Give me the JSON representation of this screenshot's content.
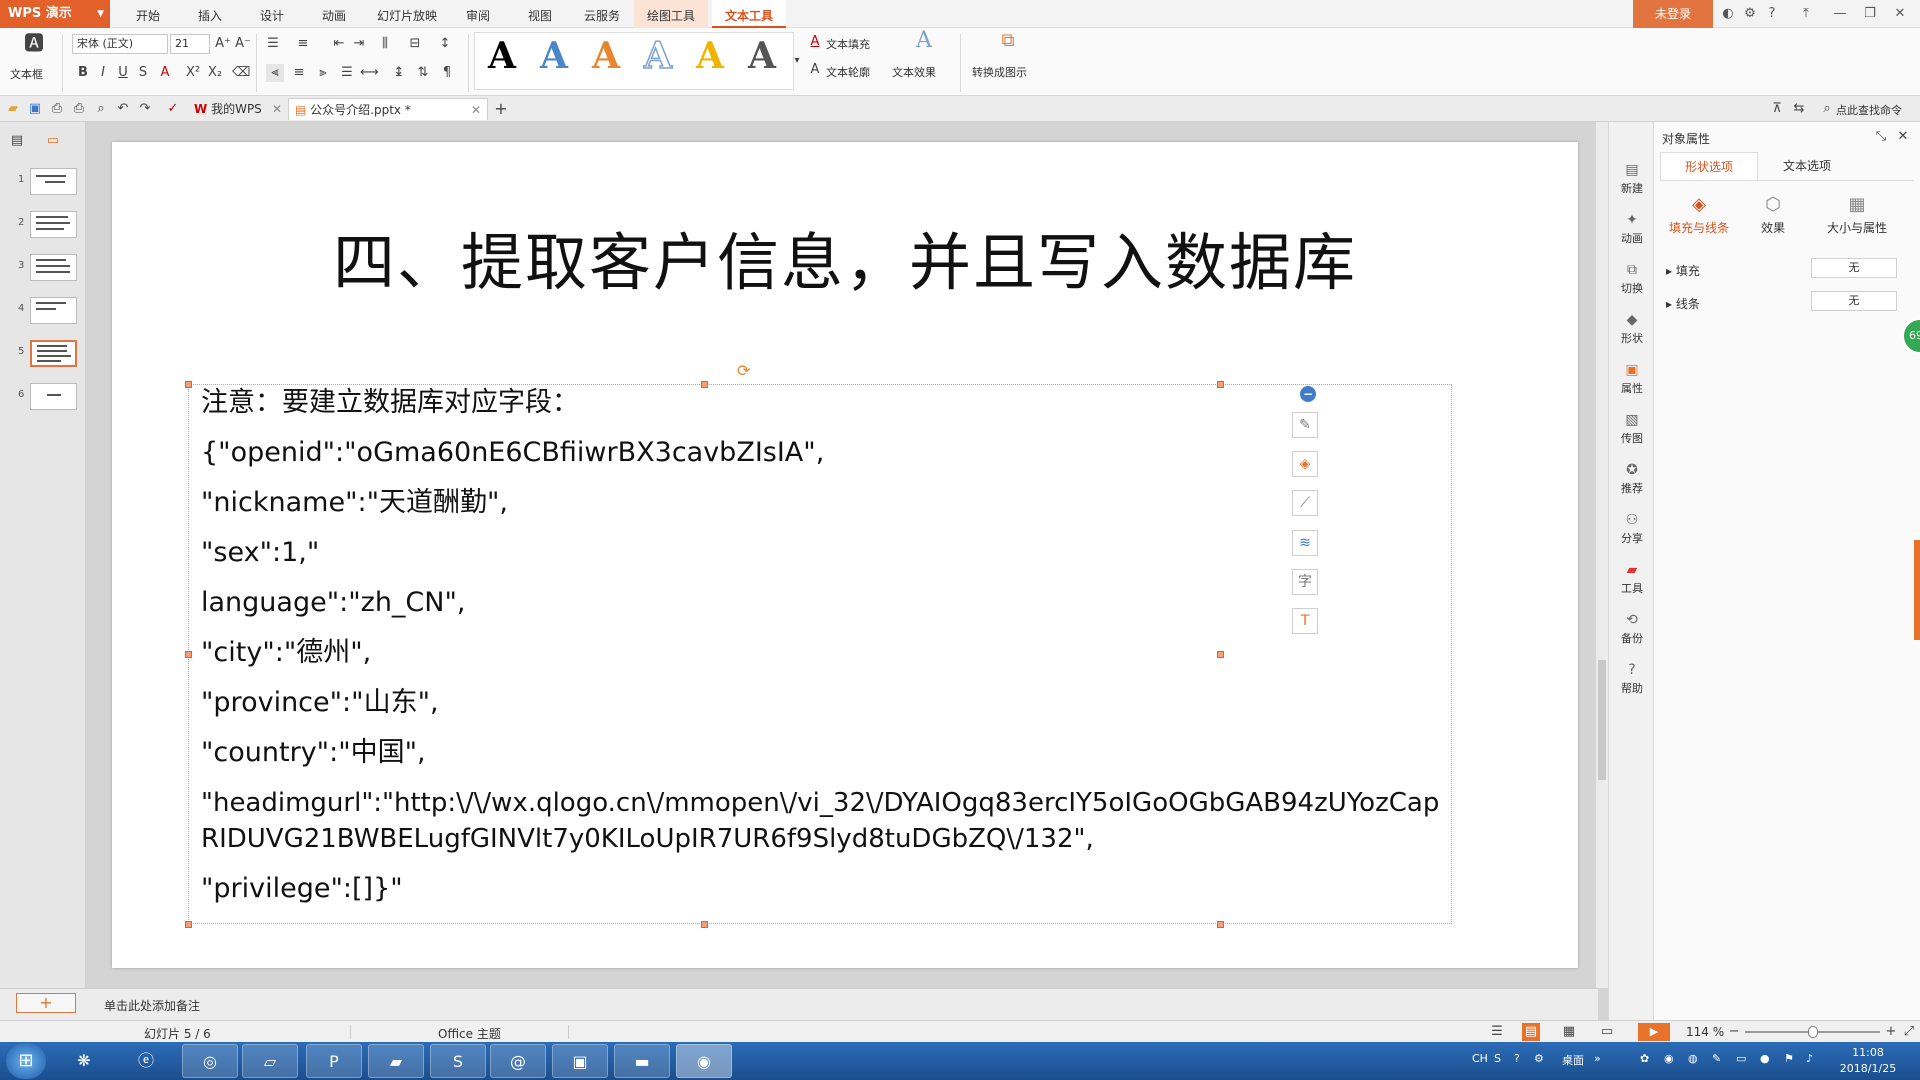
{
  "app": {
    "name": "WPS 演示"
  },
  "menu": {
    "tabs": [
      "开始",
      "插入",
      "设计",
      "动画",
      "幻灯片放映",
      "审阅",
      "视图",
      "云服务",
      "绘图工具",
      "文本工具"
    ],
    "login_label": "未登录"
  },
  "ribbon": {
    "textbox_label": "文本框",
    "font_name": "宋体 (正文)",
    "font_size": "21",
    "text_fill_label": "文本填充",
    "text_outline_label": "文本轮廓",
    "text_effect_label": "文本效果",
    "convert_label": "转换成图示",
    "style_letter": "A",
    "style_colors": [
      "#000000",
      "#4a86c8",
      "#e8862d",
      "#7da2cf",
      "#f0b400",
      "#555555"
    ]
  },
  "doc_tabs": {
    "my_wps": "我的WPS",
    "active_doc": "公众号介绍.pptx *",
    "search_cmd": "点此查找命令"
  },
  "thumbnails": {
    "numbers": [
      "1",
      "2",
      "3",
      "4",
      "5",
      "6"
    ],
    "selected": 5
  },
  "slide": {
    "title": "四、提取客户信息，并且写入数据库",
    "lines": [
      "注意：要建立数据库对应字段：",
      "{\"openid\":\"oGma60nE6CBfiiwrBX3cavbZIsIA\",",
      "\"nickname\":\"天道酬勤\",",
      "\"sex\":1,\"",
      "language\":\"zh_CN\",",
      "\"city\":\"德州\",",
      "\"province\":\"山东\",",
      "\"country\":\"中国\",",
      "\"headimgurl\":\"http:\\/\\/wx.qlogo.cn\\/mmopen\\/vi_32\\/DYAIOgq83ercIY5oIGoOGbGAB94zUYozCapRIDUVG21BWBELugfGINVlt7y0KILoUpIR7UR6f9Slyd8tuDGbZQ\\/132\",",
      "\"privilege\":[]}\""
    ]
  },
  "notes": {
    "placeholder": "单击此处添加备注"
  },
  "vtools": [
    "新建",
    "动画",
    "切换",
    "形状",
    "属性",
    "传图",
    "推荐",
    "分享",
    "工具",
    "备份",
    "帮助"
  ],
  "props": {
    "header": "对象属性",
    "tab_shape": "形状选项",
    "tab_text": "文本选项",
    "sub_fill_line": "填充与线条",
    "sub_effect": "效果",
    "sub_size": "大小与属性",
    "fill_label": "填充",
    "fill_value": "无",
    "line_label": "线条",
    "line_value": "无",
    "badge": "69"
  },
  "status": {
    "slide_counter": "幻灯片 5 / 6",
    "theme": "Office 主题",
    "zoom": "114 %"
  },
  "taskbar": {
    "ime": "CH",
    "desktop": "桌面",
    "time": "11:08",
    "date": "2018/1/25"
  }
}
